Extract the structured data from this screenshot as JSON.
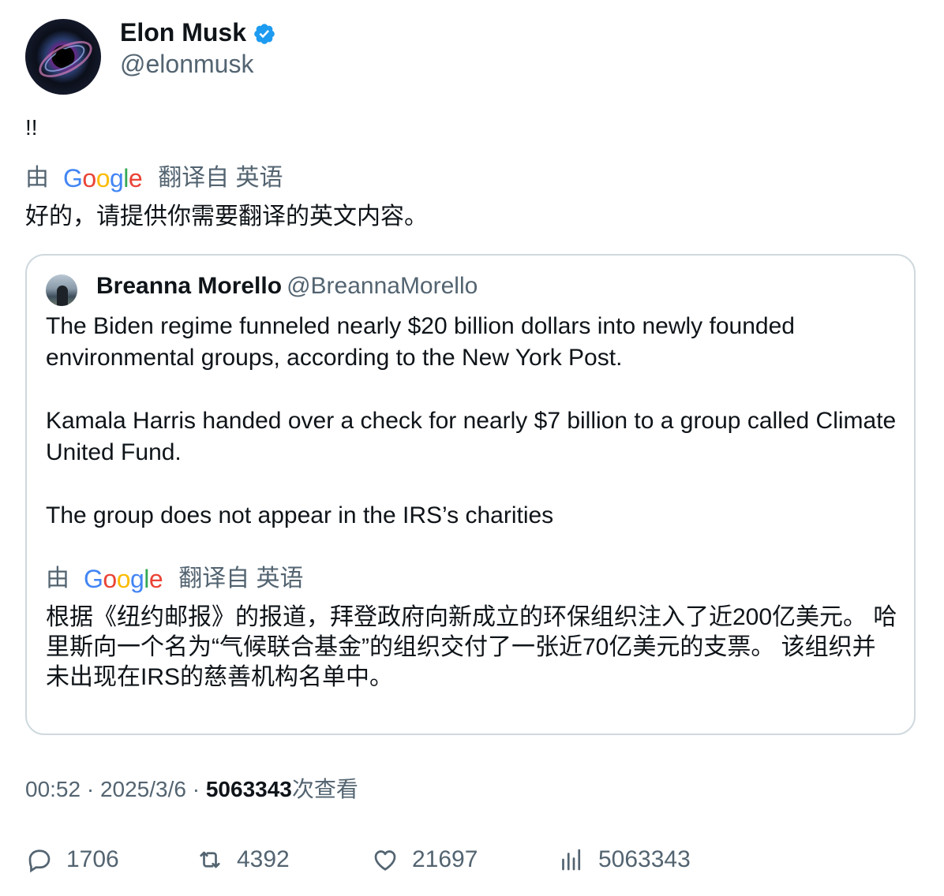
{
  "author": {
    "name": "Elon Musk",
    "handle": "@elonmusk",
    "verified": true,
    "avatar_icon": "black-hole-avatar"
  },
  "tweet": {
    "text": "!!",
    "translation_label": {
      "prefix": "由",
      "brand": "Google",
      "suffix": "翻译自 英语"
    },
    "translated_text": "好的，请提供你需要翻译的英文内容。"
  },
  "quote": {
    "name": "Breanna Morello",
    "handle": "@BreannaMorello",
    "paragraphs": [
      "The Biden regime funneled nearly $20 billion dollars into newly founded environmental groups, according to the New York Post.",
      "Kamala Harris handed over a check for nearly $7 billion to a group called Climate United Fund.",
      "The group does not appear in the IRS’s charities"
    ],
    "translation_label": {
      "prefix": "由",
      "brand": "Google",
      "suffix": "翻译自 英语"
    },
    "translated_text": "根据《纽约邮报》的报道，拜登政府向新成立的环保组织注入了近200亿美元。 哈里斯向一个名为“气候联合基金”的组织交付了一张近70亿美元的支票。 该组织并未出现在IRS的慈善机构名单中。"
  },
  "meta": {
    "time": "00:52",
    "date": "2025/3/6",
    "views_count": "5063343",
    "views_label": "次查看"
  },
  "actions": {
    "replies": "1706",
    "retweets": "4392",
    "likes": "21697",
    "views": "5063343"
  },
  "colors": {
    "text": "#0f1419",
    "secondary": "#536471",
    "border": "#cfd9de",
    "verified": "#1d9bf0"
  }
}
